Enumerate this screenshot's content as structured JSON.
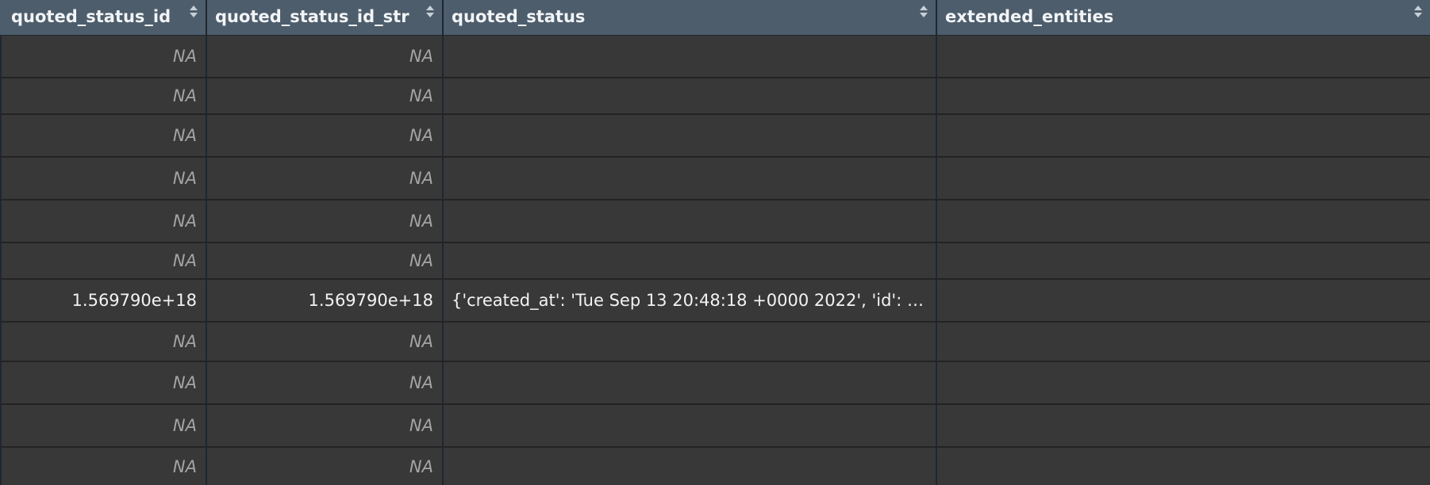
{
  "columns": [
    {
      "label": "quoted_status_id"
    },
    {
      "label": "quoted_status_id_str"
    },
    {
      "label": "quoted_status"
    },
    {
      "label": "extended_entities"
    }
  ],
  "rows": [
    {
      "c1": "NA",
      "c2": "NA",
      "c3": "",
      "c4": ""
    },
    {
      "c1": "NA",
      "c2": "NA",
      "c3": "",
      "c4": ""
    },
    {
      "c1": "NA",
      "c2": "NA",
      "c3": "",
      "c4": ""
    },
    {
      "c1": "NA",
      "c2": "NA",
      "c3": "",
      "c4": ""
    },
    {
      "c1": "NA",
      "c2": "NA",
      "c3": "",
      "c4": ""
    },
    {
      "c1": "NA",
      "c2": "NA",
      "c3": "",
      "c4": ""
    },
    {
      "c1": "1.569790e+18",
      "c2": "1.569790e+18",
      "c3": "{'created_at': 'Tue Sep 13 20:48:18 +0000 2022', 'id': …",
      "c4": ""
    },
    {
      "c1": "NA",
      "c2": "NA",
      "c3": "",
      "c4": ""
    },
    {
      "c1": "NA",
      "c2": "NA",
      "c3": "",
      "c4": ""
    },
    {
      "c1": "NA",
      "c2": "NA",
      "c3": "",
      "c4": ""
    },
    {
      "c1": "NA",
      "c2": "NA",
      "c3": "",
      "c4": ""
    }
  ],
  "icons": {
    "sort": "sort-icon"
  },
  "colors": {
    "header_bg": "#4d5d6c",
    "row_bg": "#383838",
    "na_text": "#a4a4a4"
  }
}
